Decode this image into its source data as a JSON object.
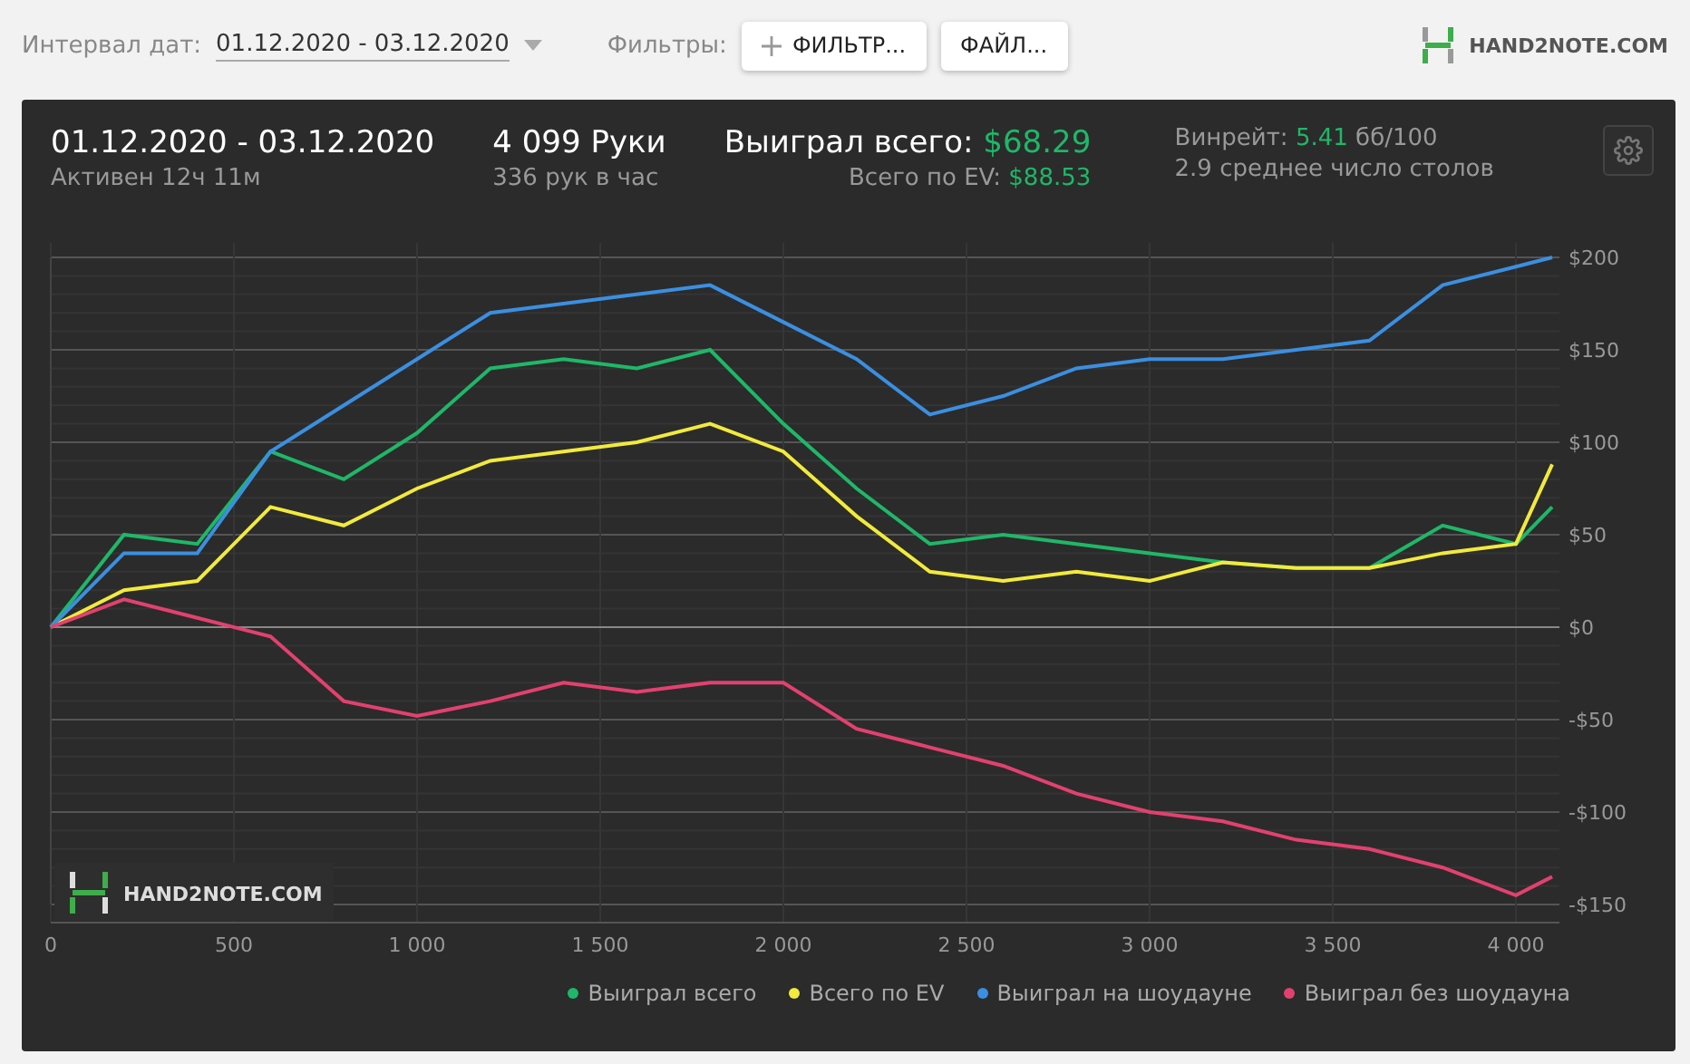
{
  "toolbar": {
    "date_label": "Интервал дат:",
    "date_range": "01.12.2020 - 03.12.2020",
    "filters_label": "Фильтры:",
    "buttons": [
      {
        "kind": "add",
        "label": "ФИЛЬТР..."
      },
      {
        "kind": "plain",
        "label": "ФАЙЛ..."
      }
    ],
    "logo": "HAND2NOTE.COM"
  },
  "summary": {
    "period": "01.12.2020 - 03.12.2020",
    "active": "Активен 12ч 11м",
    "hands": "4 099 Руки",
    "hands_rate": "336 рук в час",
    "won_label": "Выиграл всего:",
    "won_value": "$68.29",
    "ev_label": "Всего по EV:",
    "ev_value": "$88.53",
    "winrate_label": "Винрейт:",
    "winrate_value": "5.41",
    "winrate_unit": "бб/100",
    "tables": "2.9 среднее число столов"
  },
  "chart": {
    "logo": "HAND2NOTE.COM",
    "chart_data": {
      "type": "line",
      "x": [
        0,
        200,
        400,
        600,
        800,
        1000,
        1200,
        1400,
        1600,
        1800,
        2000,
        2200,
        2400,
        2600,
        2800,
        3000,
        3200,
        3400,
        3600,
        3800,
        4000,
        4099
      ],
      "xlim": [
        0,
        4099
      ],
      "ylim": [
        -150,
        200
      ],
      "grid": true,
      "xticks": [
        {
          "value": 0,
          "label": "0"
        },
        {
          "value": 500,
          "label": "500"
        },
        {
          "value": 1000,
          "label": "1 000"
        },
        {
          "value": 1500,
          "label": "1 500"
        },
        {
          "value": 2000,
          "label": "2 000"
        },
        {
          "value": 2500,
          "label": "2 500"
        },
        {
          "value": 3000,
          "label": "3 000"
        },
        {
          "value": 3500,
          "label": "3 500"
        },
        {
          "value": 4000,
          "label": "4 000"
        }
      ],
      "yticks": [
        {
          "value": 200,
          "label": "$200"
        },
        {
          "value": 150,
          "label": "$150"
        },
        {
          "value": 100,
          "label": "$100"
        },
        {
          "value": 50,
          "label": "$50"
        },
        {
          "value": 0,
          "label": "$0"
        },
        {
          "value": -50,
          "label": "-$50"
        },
        {
          "value": -100,
          "label": "-$100"
        },
        {
          "value": -150,
          "label": "-$150"
        }
      ],
      "series": [
        {
          "name": "Выиграл всего",
          "color": "#1fb768",
          "values": [
            0,
            50,
            45,
            95,
            80,
            105,
            140,
            145,
            140,
            150,
            110,
            75,
            45,
            50,
            45,
            40,
            35,
            32,
            32,
            55,
            45,
            65
          ]
        },
        {
          "name": "Всего по EV",
          "color": "#f2ea3c",
          "values": [
            0,
            20,
            25,
            65,
            55,
            75,
            90,
            95,
            100,
            110,
            95,
            60,
            30,
            25,
            30,
            25,
            35,
            32,
            32,
            40,
            45,
            88
          ]
        },
        {
          "name": "Выиграл на шоудауне",
          "color": "#3b8fe0",
          "values": [
            0,
            40,
            40,
            95,
            120,
            145,
            170,
            175,
            180,
            185,
            165,
            145,
            115,
            125,
            140,
            145,
            145,
            150,
            155,
            185,
            195,
            200
          ]
        },
        {
          "name": "Выиграл без шоудауна",
          "color": "#e2416f",
          "values": [
            0,
            15,
            5,
            -5,
            -40,
            -48,
            -40,
            -30,
            -35,
            -30,
            -30,
            -55,
            -65,
            -75,
            -90,
            -100,
            -105,
            -115,
            -120,
            -130,
            -145,
            -135
          ]
        }
      ]
    }
  }
}
